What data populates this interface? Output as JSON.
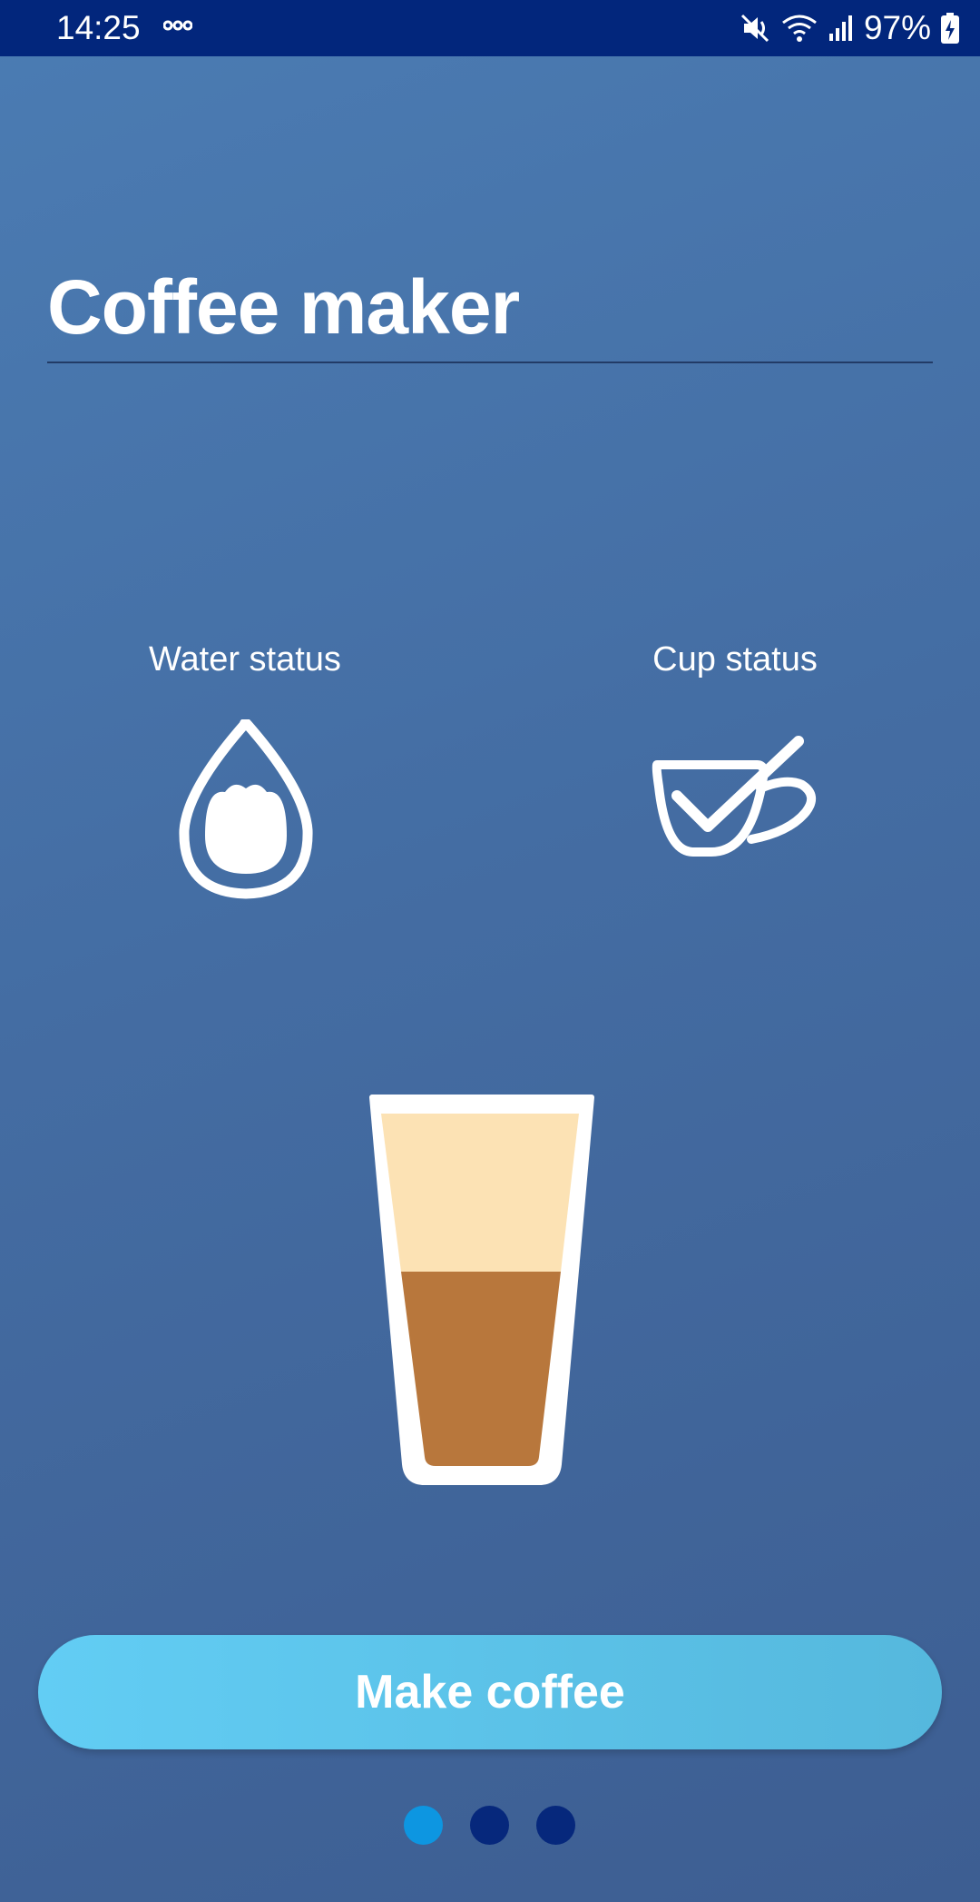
{
  "status_bar": {
    "time": "14:25",
    "battery": "97%",
    "icons": [
      "link-icon",
      "mute-icon",
      "wifi-icon",
      "signal-icon",
      "battery-charging-icon"
    ]
  },
  "page": {
    "title": "Coffee maker"
  },
  "water_status": {
    "label": "Water status",
    "icon": "water-drop-icon"
  },
  "cup_status": {
    "label": "Cup status",
    "icon": "cup-check-icon"
  },
  "coffee_glass": {
    "icon": "coffee-glass-icon",
    "fill_fraction_coffee": 0.5,
    "colors": {
      "foam": "#fce2b4",
      "coffee": "#b8773c",
      "outline": "#ffffff"
    }
  },
  "action": {
    "make_coffee_label": "Make coffee"
  },
  "pager": {
    "pages": 3,
    "active_index": 0
  },
  "theme": {
    "status_bar_color": "#02267c",
    "background_top": "#4b7cb3",
    "background_bottom": "#3d5e92",
    "button_color": "#5ec6ee",
    "dot_active": "#0d96e1",
    "dot_inactive": "#06287c"
  }
}
